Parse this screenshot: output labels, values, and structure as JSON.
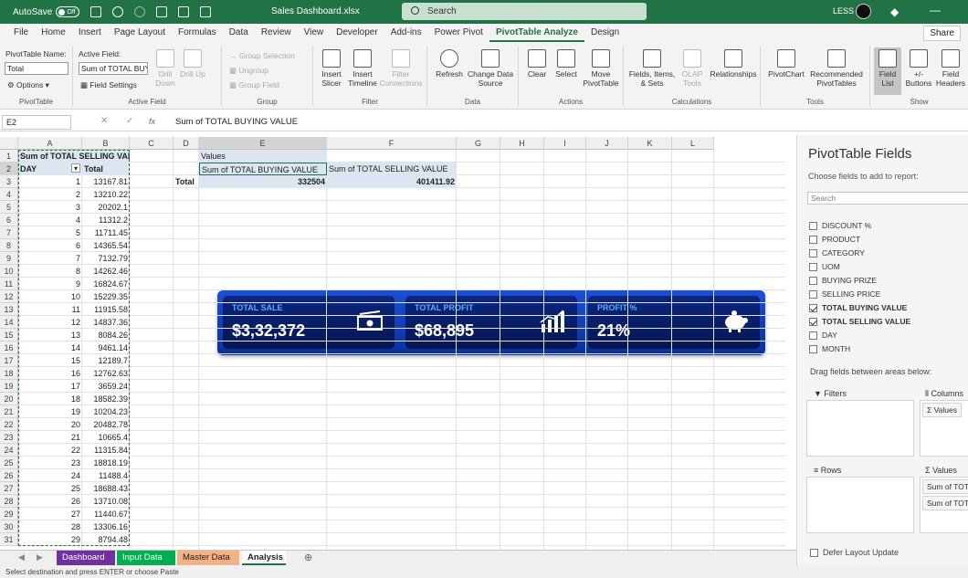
{
  "titlebar": {
    "autosave": "AutoSave",
    "toggle": "Off",
    "filename": "Sales Dashboard.xlsx",
    "search_placeholder": "Search",
    "user": "LESS"
  },
  "tabs": [
    "File",
    "Home",
    "Insert",
    "Page Layout",
    "Formulas",
    "Data",
    "Review",
    "View",
    "Developer",
    "Add-ins",
    "Power Pivot",
    "PivotTable Analyze",
    "Design"
  ],
  "active_tab": "PivotTable Analyze",
  "share": "Share",
  "ribbon": {
    "pt_name_label": "PivotTable Name:",
    "pt_name_value": "Total",
    "options": "Options",
    "pivottable_group": "PivotTable",
    "active_field_label": "Active Field:",
    "active_field_value": "Sum of TOTAL BUY",
    "field_settings": "Field Settings",
    "drill_down": "Drill Down",
    "drill_up": "Drill Up",
    "active_field_group": "Active Field",
    "group_selection": "Group Selection",
    "ungroup": "Ungroup",
    "group_field": "Group Field",
    "group_group": "Group",
    "insert_slicer": "Insert Slicer",
    "insert_timeline": "Insert Timeline",
    "filter_connections": "Filter Connections",
    "filter_group": "Filter",
    "refresh": "Refresh",
    "change_source": "Change Data Source",
    "data_group": "Data",
    "clear": "Clear",
    "select": "Select",
    "move_pt": "Move PivotTable",
    "actions_group": "Actions",
    "fields_items": "Fields, Items, & Sets",
    "olap_tools": "OLAP Tools",
    "relationships": "Relationships",
    "calculations_group": "Calculations",
    "pivotchart": "PivotChart",
    "recommended": "Recommended PivotTables",
    "tools_group": "Tools",
    "field_list": "Field List",
    "buttons": "+/- Buttons",
    "field_headers": "Field Headers",
    "show_group": "Show"
  },
  "formula_bar": {
    "name_box": "E2",
    "fx": "fx",
    "formula": "Sum of TOTAL BUYING VALUE"
  },
  "columns": [
    "A",
    "B",
    "C",
    "D",
    "E",
    "F",
    "G",
    "H",
    "I",
    "J",
    "K",
    "L"
  ],
  "rows": [
    "1",
    "2",
    "3",
    "4",
    "5",
    "6",
    "7",
    "8",
    "9",
    "10",
    "11",
    "12",
    "13",
    "14",
    "15",
    "16",
    "17",
    "18",
    "19",
    "20",
    "21",
    "22",
    "23",
    "24",
    "25",
    "26",
    "27",
    "28",
    "29",
    "30",
    "31"
  ],
  "pivot1": {
    "title": "Sum of TOTAL SELLING VALUE",
    "row_label": "DAY",
    "total_label": "Total",
    "days": [
      "1",
      "2",
      "3",
      "4",
      "5",
      "6",
      "7",
      "8",
      "9",
      "10",
      "11",
      "12",
      "13",
      "14",
      "15",
      "16",
      "17",
      "18",
      "19",
      "20",
      "21",
      "22",
      "23",
      "24",
      "25",
      "26",
      "27",
      "28",
      "29"
    ],
    "totals": [
      "13167.81",
      "13210.22",
      "20202.1",
      "11312.2",
      "11711.45",
      "14365.54",
      "7132.79",
      "14262.46",
      "16824.67",
      "15229.35",
      "11915.58",
      "14837.36",
      "8084.26",
      "9461.14",
      "12189.7",
      "12762.63",
      "3659.24",
      "18582.39",
      "10204.23",
      "20482.78",
      "10665.4",
      "11315.84",
      "18818.19",
      "11488.4",
      "18688.43",
      "13710.08",
      "11440.67",
      "13306.16",
      "8794.48"
    ]
  },
  "pivot2": {
    "values_label": "Values",
    "col1": "Sum of TOTAL BUYING VALUE",
    "col2": "Sum of TOTAL SELLING VALUE",
    "row_label": "Total",
    "v1": "332504",
    "v2": "401411.92"
  },
  "kpis": [
    {
      "label": "TOTAL SALE",
      "value": "$3,32,372",
      "icon": "cash-icon"
    },
    {
      "label": "TOTAL PROFIT",
      "value": "$68,895",
      "icon": "bar-chart-icon"
    },
    {
      "label": "PROFIT %",
      "value": "21%",
      "icon": "piggy-bank-icon"
    }
  ],
  "pane": {
    "title": "PivotTable Fields",
    "subtitle": "Choose fields to add to report:",
    "search": "Search",
    "fields": [
      {
        "name": "DISCOUNT %",
        "checked": false
      },
      {
        "name": "PRODUCT",
        "checked": false
      },
      {
        "name": "CATEGORY",
        "checked": false
      },
      {
        "name": "UOM",
        "checked": false
      },
      {
        "name": "BUYING PRIZE",
        "checked": false
      },
      {
        "name": "SELLING PRICE",
        "checked": false
      },
      {
        "name": "TOTAL BUYING VALUE",
        "checked": true
      },
      {
        "name": "TOTAL SELLING VALUE",
        "checked": true
      },
      {
        "name": "DAY",
        "checked": false
      },
      {
        "name": "MONTH",
        "checked": false
      }
    ],
    "drag_text": "Drag fields between areas below:",
    "filters": "Filters",
    "columns": "Columns",
    "columns_item": "Σ Values",
    "rows": "Rows",
    "values": "Values",
    "values_items": [
      "Sum of TOTA",
      "Sum of TOTA"
    ],
    "defer": "Defer Layout Update"
  },
  "sheets": [
    {
      "name": "Dashboard",
      "color": "#7030a0"
    },
    {
      "name": "Input Data",
      "color": "#00b050"
    },
    {
      "name": "Master Data",
      "color": "#f4b183"
    },
    {
      "name": "Analysis",
      "color": "#ffffff"
    }
  ],
  "status": "Select destination and press ENTER or choose Paste"
}
